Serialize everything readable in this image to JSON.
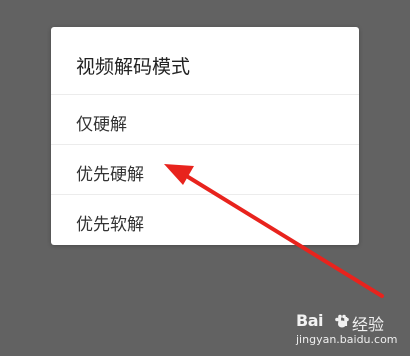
{
  "dialog": {
    "title": "视频解码模式",
    "options": [
      {
        "label": "仅硬解"
      },
      {
        "label": "优先硬解"
      },
      {
        "label": "优先软解"
      }
    ]
  },
  "annotation": {
    "color": "#e8231d",
    "points_to": "优先硬解"
  },
  "watermark": {
    "logo_prefix": "Bai",
    "logo_suffix": "u",
    "logo_cn": "经验",
    "url": "jingyan.baidu.com"
  },
  "colors": {
    "backdrop": "#626262",
    "dialog_bg": "#ffffff",
    "divider": "#ececec"
  }
}
